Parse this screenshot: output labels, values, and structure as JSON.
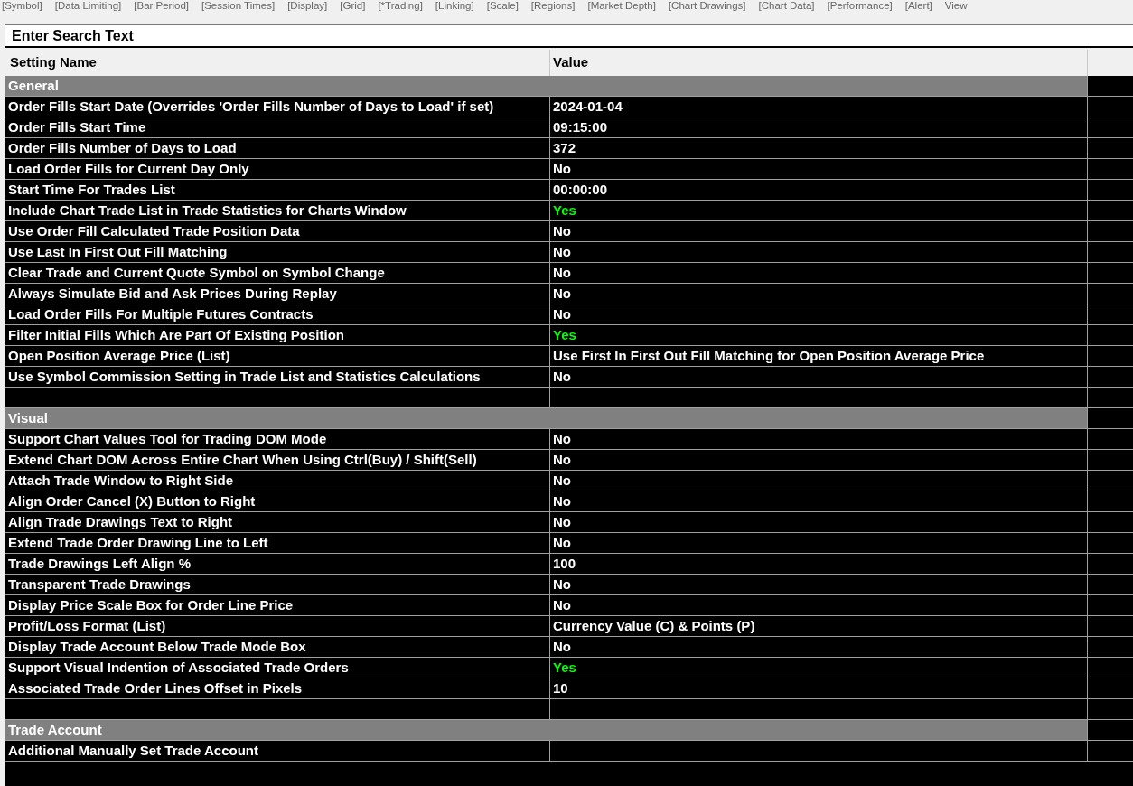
{
  "tabs": [
    {
      "label": "[Symbol]"
    },
    {
      "label": "[Data Limiting]"
    },
    {
      "label": "[Bar Period]"
    },
    {
      "label": "[Session Times]"
    },
    {
      "label": "[Display]"
    },
    {
      "label": "[Grid]"
    },
    {
      "label": "[*Trading]"
    },
    {
      "label": "[Linking]"
    },
    {
      "label": "[Scale]"
    },
    {
      "label": "[Regions]"
    },
    {
      "label": "[Market Depth]"
    },
    {
      "label": "[Chart Drawings]"
    },
    {
      "label": "[Chart Data]"
    },
    {
      "label": "[Performance]"
    },
    {
      "label": "[Alert]"
    },
    {
      "label": "View"
    }
  ],
  "search": {
    "placeholder": "Enter Search Text"
  },
  "table": {
    "columns": [
      "Setting Name",
      "Value"
    ],
    "groups": [
      {
        "name": "General",
        "rows": [
          {
            "name": "Order Fills Start Date (Overrides 'Order Fills Number of Days to Load' if set)",
            "value": "2024-01-04"
          },
          {
            "name": "Order Fills Start Time",
            "value": "09:15:00"
          },
          {
            "name": "Order Fills Number of Days to Load",
            "value": "372"
          },
          {
            "name": "Load Order Fills for Current Day Only",
            "value": "No"
          },
          {
            "name": "Start Time For Trades List",
            "value": "00:00:00"
          },
          {
            "name": "Include Chart Trade List in Trade Statistics for Charts Window",
            "value": "Yes",
            "color": "#00ff00"
          },
          {
            "name": "Use Order Fill Calculated Trade Position Data",
            "value": "No"
          },
          {
            "name": "Use Last In First Out Fill Matching",
            "value": "No"
          },
          {
            "name": "Clear Trade and Current Quote Symbol on Symbol Change",
            "value": "No"
          },
          {
            "name": "Always Simulate Bid and Ask Prices During Replay",
            "value": "No"
          },
          {
            "name": "Load Order Fills For Multiple Futures Contracts",
            "value": "No"
          },
          {
            "name": "Filter Initial Fills Which Are Part Of Existing Position",
            "value": "Yes",
            "color": "#00ff00"
          },
          {
            "name": "Open Position Average Price (List)",
            "value": "Use First In First Out Fill Matching for Open Position Average Price"
          },
          {
            "name": "Use Symbol Commission Setting in Trade List and Statistics Calculations",
            "value": "No"
          }
        ]
      },
      {
        "name": "Visual",
        "rows": [
          {
            "name": "Support Chart Values Tool for Trading DOM Mode",
            "value": "No"
          },
          {
            "name": "Extend Chart DOM Across Entire Chart When Using Ctrl(Buy) / Shift(Sell)",
            "value": "No"
          },
          {
            "name": "Attach Trade Window to Right Side",
            "value": "No"
          },
          {
            "name": "Align Order Cancel (X) Button to Right",
            "value": "No"
          },
          {
            "name": "Align Trade Drawings Text to Right",
            "value": "No"
          },
          {
            "name": "Extend Trade Order Drawing Line to Left",
            "value": "No"
          },
          {
            "name": "Trade Drawings Left Align %",
            "value": "100"
          },
          {
            "name": "Transparent Trade Drawings",
            "value": "No"
          },
          {
            "name": "Display Price Scale Box for Order Line Price",
            "value": "No"
          },
          {
            "name": "Profit/Loss Format (List)",
            "value": "Currency Value (C) & Points (P)"
          },
          {
            "name": "Display Trade Account Below Trade Mode Box",
            "value": "No"
          },
          {
            "name": "Support Visual Indention of Associated Trade Orders",
            "value": "Yes",
            "color": "#00ff00"
          },
          {
            "name": "Associated Trade Order Lines Offset in Pixels",
            "value": "10"
          }
        ]
      },
      {
        "name": "Trade Account",
        "rows": [
          {
            "name": "Additional Manually Set Trade Account"
          }
        ]
      }
    ]
  }
}
